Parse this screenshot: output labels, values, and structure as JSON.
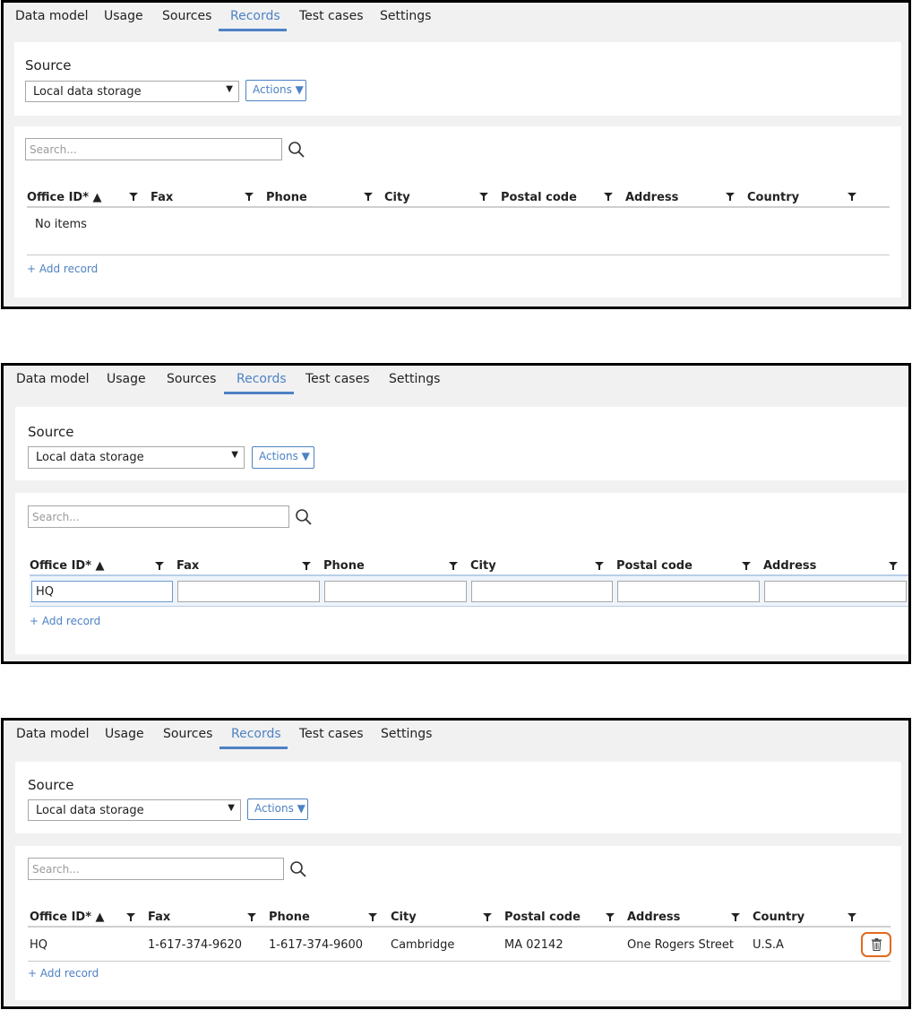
{
  "tabs": [
    "Data model",
    "Usage",
    "Sources",
    "Records",
    "Test cases",
    "Settings"
  ],
  "source": {
    "label": "Source",
    "selected": "Local data storage",
    "actions_label": "Actions ▼"
  },
  "search": {
    "placeholder": "Search..."
  },
  "columns": [
    "Office ID* ▲",
    "Fax",
    "Phone",
    "City",
    "Postal code",
    "Address",
    "Country"
  ],
  "states": {
    "empty": {
      "message": "No items"
    },
    "editing": {
      "office_id_value": "HQ"
    },
    "saved": {
      "row": [
        "HQ",
        "1-617-374-9620",
        "1-617-374-9600",
        "Cambridge",
        "MA 02142",
        "One Rogers Street",
        "U.S.A"
      ]
    }
  },
  "add_record_label": "+ Add record",
  "colors": {
    "accent": "#4d82c4",
    "highlight": "#e06a1f"
  },
  "icons": [
    "caret-down-icon",
    "search-icon",
    "filter-icon",
    "trash-icon"
  ]
}
